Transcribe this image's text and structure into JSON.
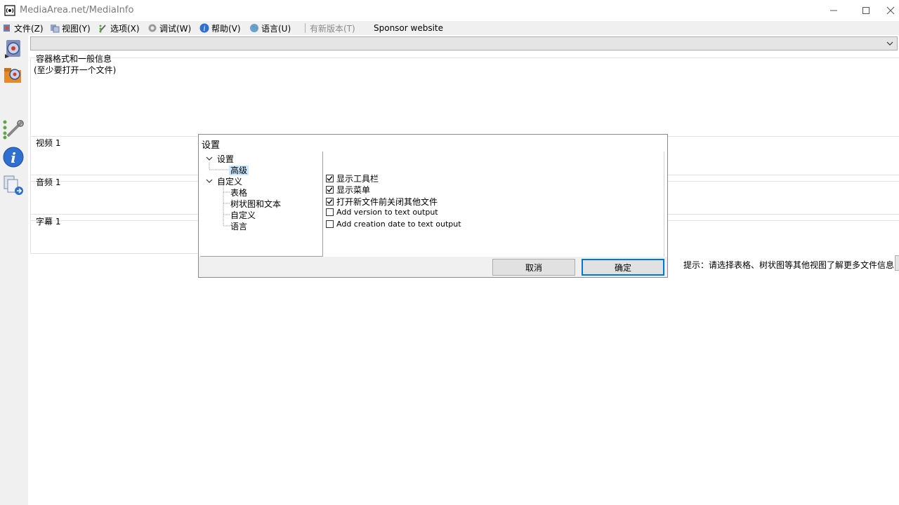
{
  "window": {
    "title": "MediaArea.net/MediaInfo"
  },
  "menu": {
    "items": [
      {
        "label": "文件(Z)",
        "icon": "file-icon"
      },
      {
        "label": "视图(Y)",
        "icon": "view-icon"
      },
      {
        "label": "选项(X)",
        "icon": "options-icon"
      },
      {
        "label": "调试(W)",
        "icon": "debug-icon"
      },
      {
        "label": "帮助(V)",
        "icon": "help-icon"
      },
      {
        "label": "语言(U)",
        "icon": "language-icon"
      }
    ],
    "new_version": "有新版本(T)",
    "sponsor": "Sponsor website"
  },
  "file_combo": {
    "value": ""
  },
  "sections": {
    "general_title": "容器格式和一般信息",
    "general_sub": "(至少要打开一个文件)",
    "video": "视频 1",
    "audio": "音频 1",
    "subtitle": "字幕 1"
  },
  "dialog": {
    "title": "设置",
    "tree": {
      "settings": "设置",
      "advanced": "高级",
      "customize": "自定义",
      "sheet": "表格",
      "tree_text": "树状图和文本",
      "custom": "自定义",
      "language": "语言"
    },
    "options": [
      {
        "label": "显示工具栏",
        "checked": true
      },
      {
        "label": "显示菜单",
        "checked": true
      },
      {
        "label": "打开新文件前关闭其他文件",
        "checked": true
      },
      {
        "label": "Add version to text output",
        "checked": false
      },
      {
        "label": "Add creation date to text output",
        "checked": false
      }
    ],
    "cancel_label": "取消",
    "ok_label": "确定"
  },
  "hint": "提示：请选择表格、树状图等其他视图了解更多文件信息"
}
